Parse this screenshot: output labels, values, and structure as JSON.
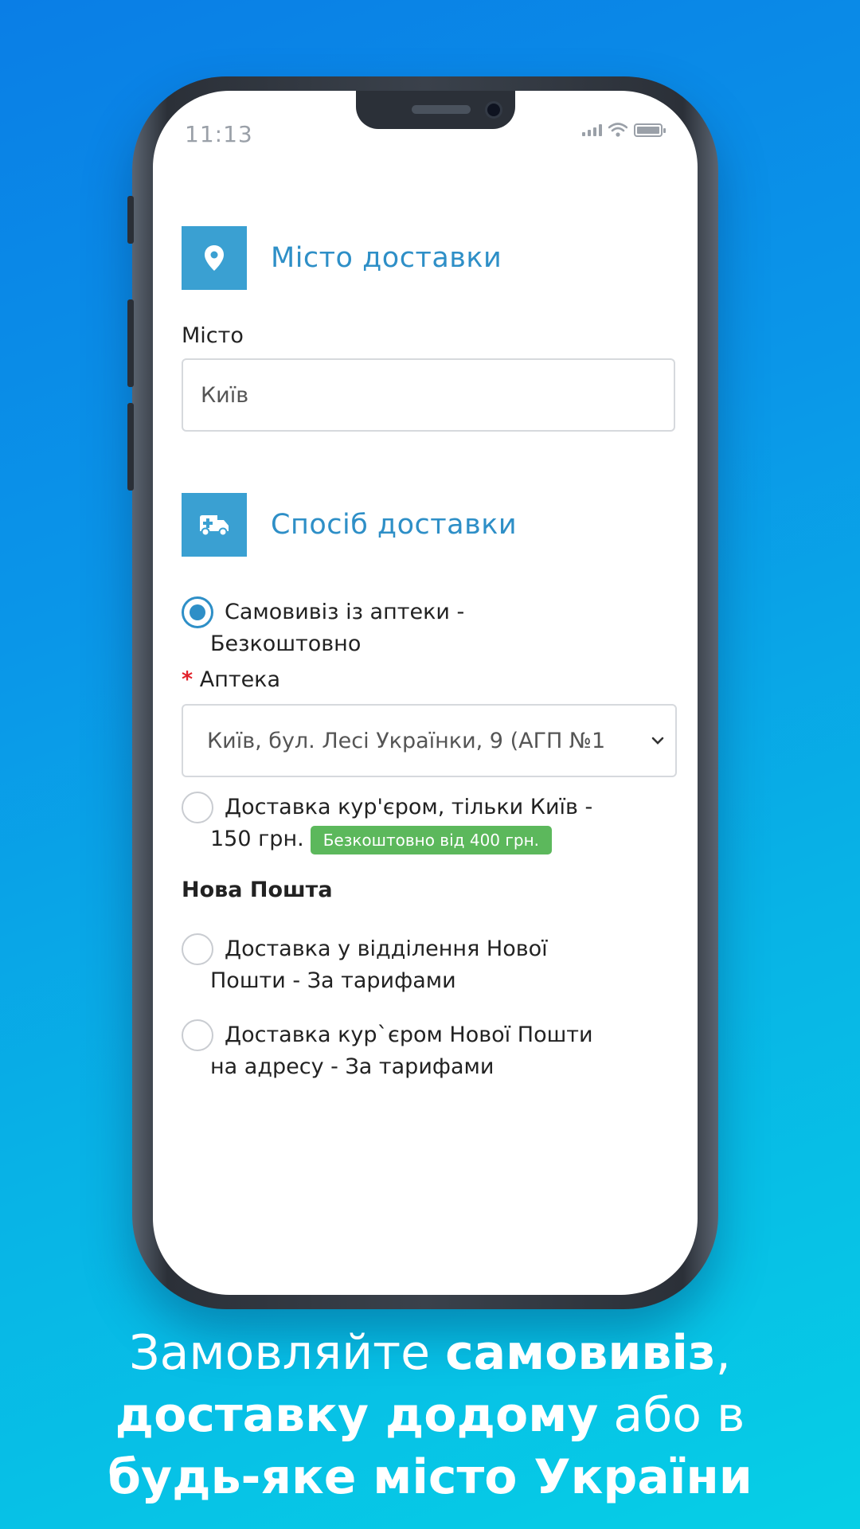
{
  "status_bar": {
    "time": "11:13"
  },
  "city_section": {
    "title": "Місто доставки",
    "icon": "map-pin-icon",
    "city_label": "Місто",
    "city_value": "Київ"
  },
  "delivery_section": {
    "title": "Спосіб доставки",
    "icon": "ambulance-icon",
    "pickup": {
      "line1": "Самовивіз із аптеки -",
      "line2": "Безкоштовно",
      "checked": true
    },
    "pharmacy_required_mark": "*",
    "pharmacy_label": "Аптека",
    "pharmacy_value": "Київ, бул. Лесі Українки, 9 (АГП №1",
    "courier": {
      "line1": "Доставка кур'єром, тільки Київ -",
      "line2": "150 грн.",
      "badge": "Безкоштовно від 400 грн.",
      "checked": false
    },
    "nova_poshta_title": "Нова Пошта",
    "np_branch": {
      "line1": "Доставка у відділення Нової",
      "line2": "Пошти - За тарифами",
      "checked": false
    },
    "np_courier": {
      "line1": "Доставка кур`єром Нової Пошти",
      "line2": "на адресу - За тарифами",
      "checked": false
    }
  },
  "caption": {
    "l1_regular": "Замовляйте ",
    "l1_bold": "самовивіз",
    "l1_end": ",",
    "l2_bold": "доставку додому",
    "l2_regular": " або в",
    "l3_bold": "будь-яке місто України"
  },
  "colors": {
    "accent": "#2e8fc7",
    "icon_bg": "#3aa0d2",
    "badge_green": "#5cb85c",
    "required_red": "#e2212a"
  }
}
